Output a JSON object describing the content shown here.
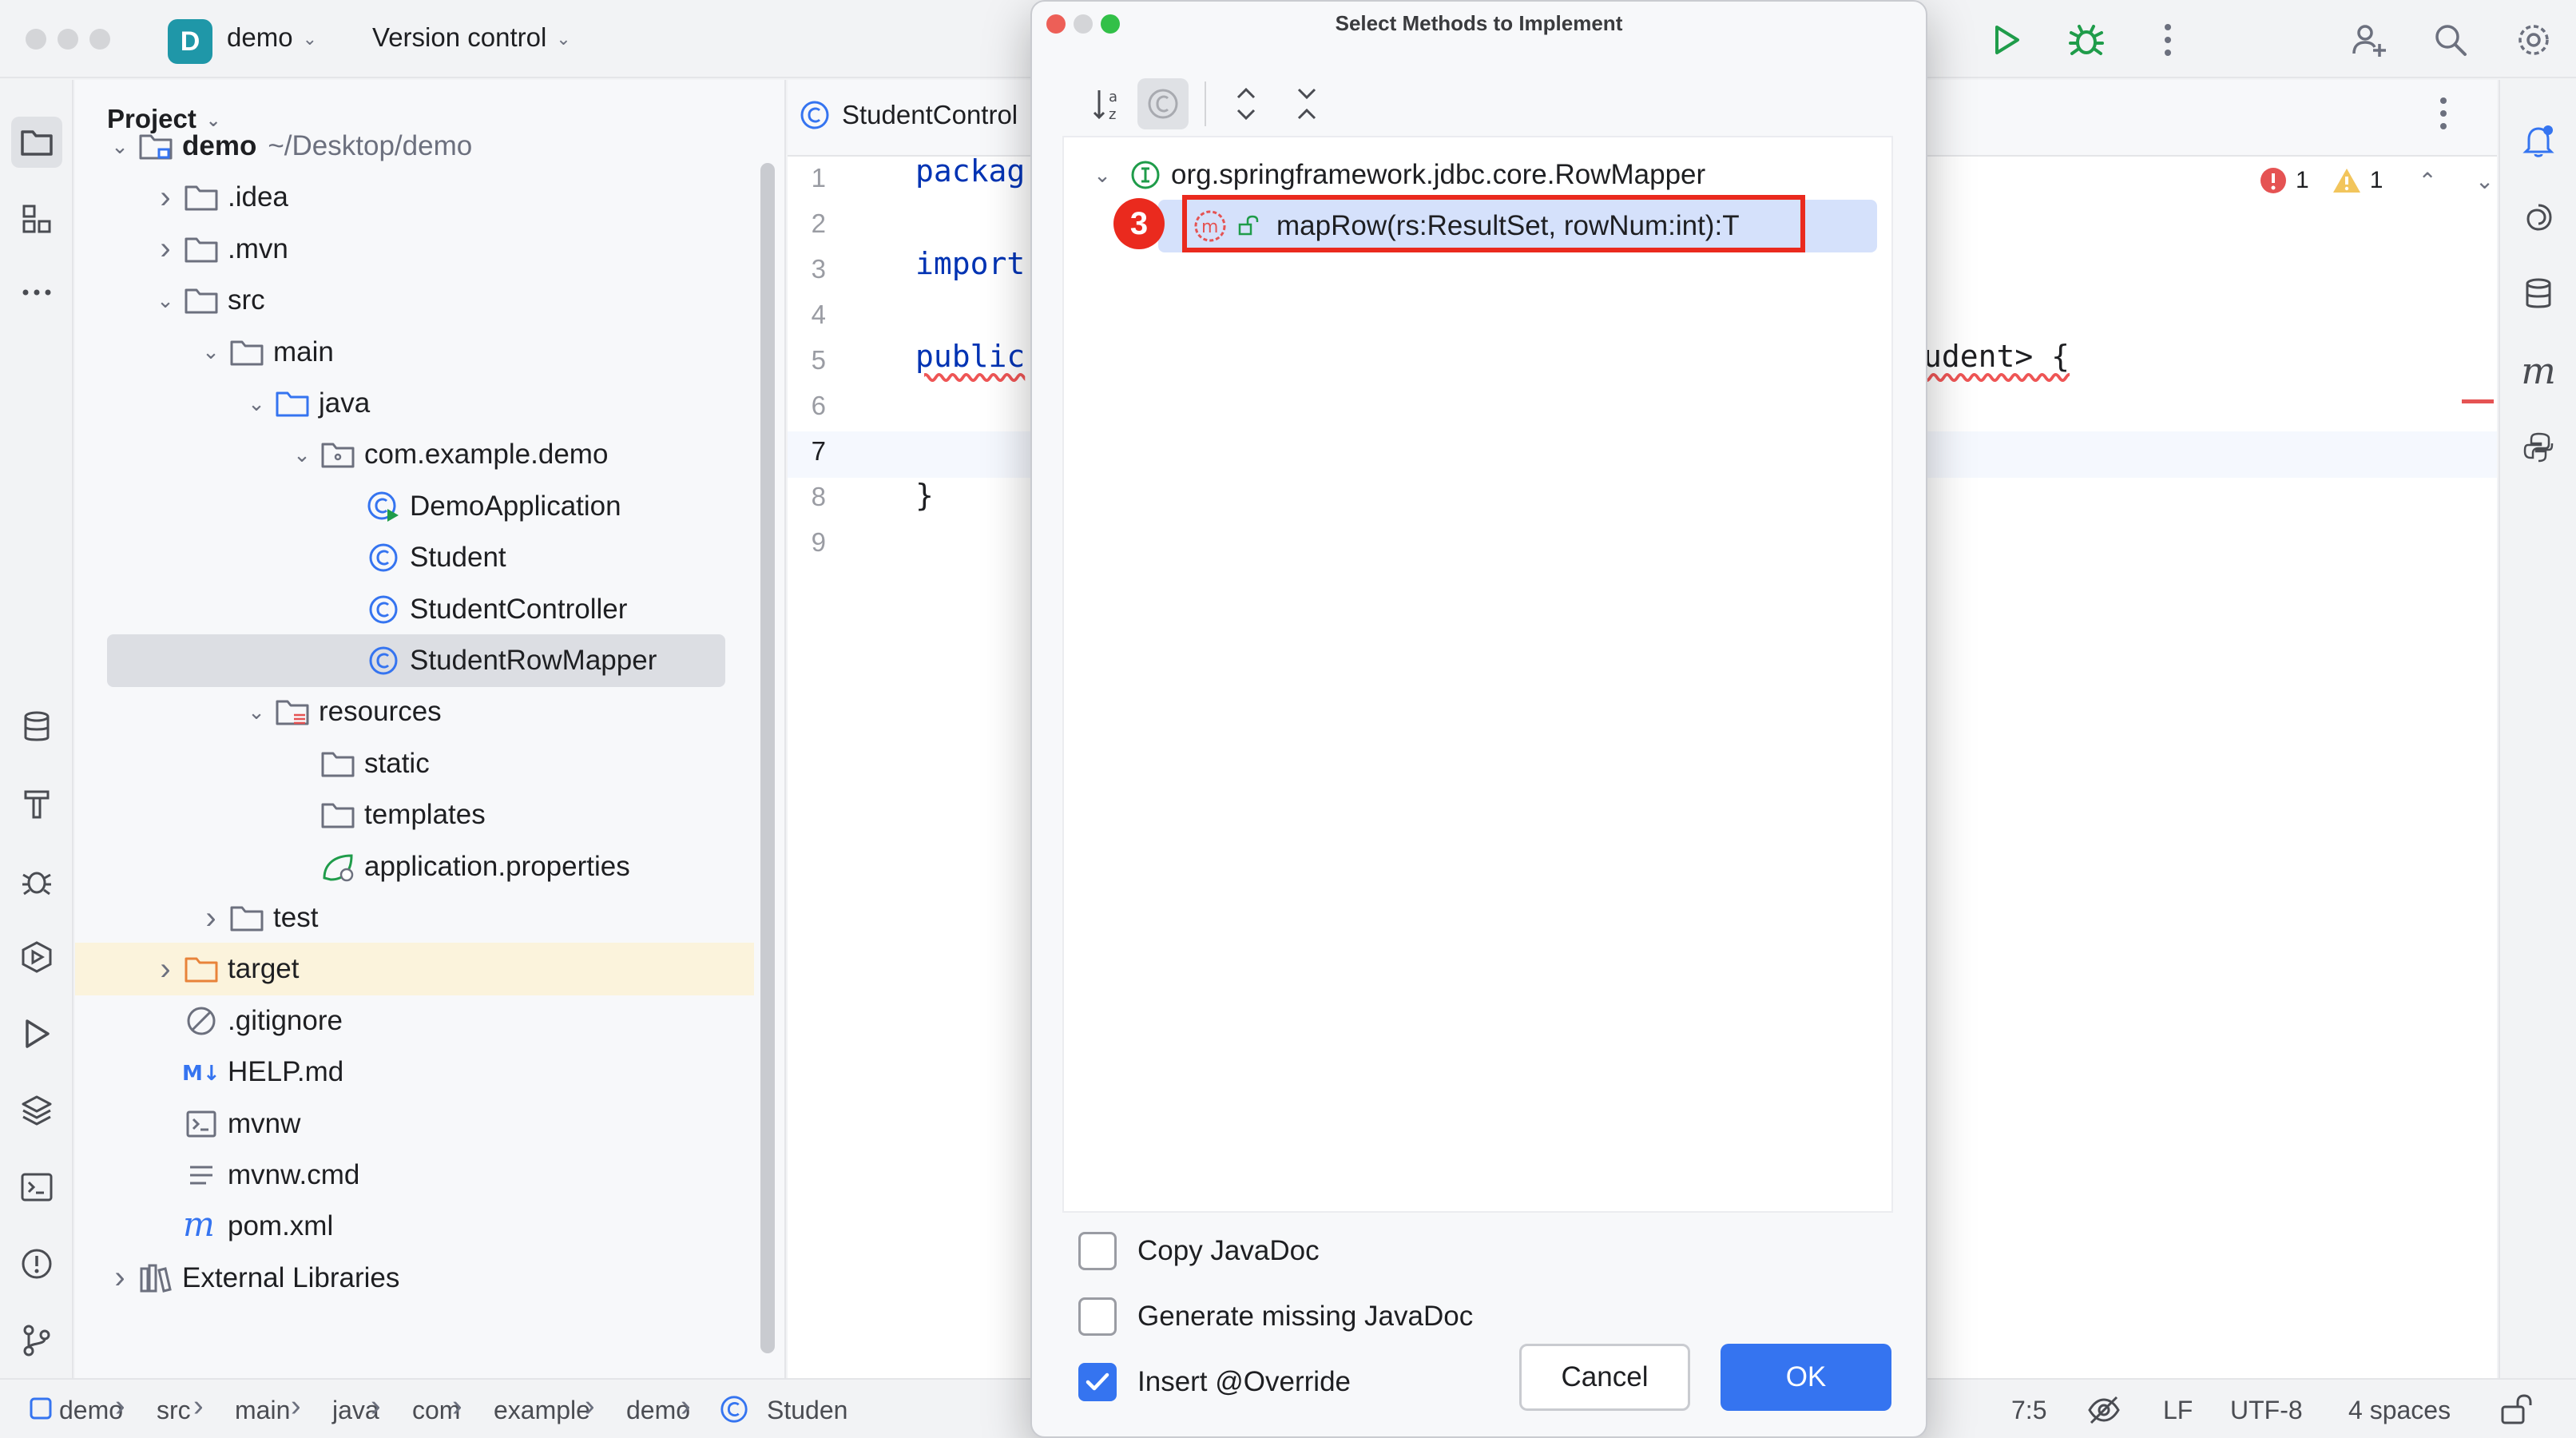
{
  "titlebar": {
    "project_badge": "D",
    "project_name": "demo",
    "vcs_label": "Version control"
  },
  "project_panel": {
    "title": "Project",
    "tree": [
      {
        "label": "demo",
        "sub": "~/Desktop/demo",
        "icon": "module-folder-icon",
        "indent": 0,
        "arrow": "down",
        "bold": true
      },
      {
        "label": ".idea",
        "icon": "folder-icon",
        "indent": 1,
        "arrow": "right"
      },
      {
        "label": ".mvn",
        "icon": "folder-icon",
        "indent": 1,
        "arrow": "right"
      },
      {
        "label": "src",
        "icon": "folder-icon",
        "indent": 1,
        "arrow": "down"
      },
      {
        "label": "main",
        "icon": "folder-icon",
        "indent": 2,
        "arrow": "down"
      },
      {
        "label": "java",
        "icon": "source-folder-icon",
        "indent": 3,
        "arrow": "down"
      },
      {
        "label": "com.example.demo",
        "icon": "package-icon",
        "indent": 4,
        "arrow": "down"
      },
      {
        "label": "DemoApplication",
        "icon": "spring-class-icon",
        "indent": 5,
        "arrow": ""
      },
      {
        "label": "Student",
        "icon": "class-icon",
        "indent": 5,
        "arrow": ""
      },
      {
        "label": "StudentController",
        "icon": "class-icon",
        "indent": 5,
        "arrow": ""
      },
      {
        "label": "StudentRowMapper",
        "icon": "class-icon",
        "indent": 5,
        "arrow": "",
        "selected": true
      },
      {
        "label": "resources",
        "icon": "resources-folder-icon",
        "indent": 3,
        "arrow": "down"
      },
      {
        "label": "static",
        "icon": "folder-icon",
        "indent": 4,
        "arrow": ""
      },
      {
        "label": "templates",
        "icon": "folder-icon",
        "indent": 4,
        "arrow": ""
      },
      {
        "label": "application.properties",
        "icon": "spring-properties-icon",
        "indent": 4,
        "arrow": ""
      },
      {
        "label": "test",
        "icon": "folder-icon",
        "indent": 2,
        "arrow": "right"
      },
      {
        "label": "target",
        "icon": "excluded-folder-icon",
        "indent": 1,
        "arrow": "right",
        "highlight": true
      },
      {
        "label": ".gitignore",
        "icon": "ignore-file-icon",
        "indent": 1,
        "arrow": ""
      },
      {
        "label": "HELP.md",
        "icon": "markdown-icon",
        "indent": 1,
        "arrow": ""
      },
      {
        "label": "mvnw",
        "icon": "shell-script-icon",
        "indent": 1,
        "arrow": ""
      },
      {
        "label": "mvnw.cmd",
        "icon": "text-file-icon",
        "indent": 1,
        "arrow": ""
      },
      {
        "label": "pom.xml",
        "icon": "maven-icon",
        "indent": 1,
        "arrow": ""
      },
      {
        "label": "External Libraries",
        "icon": "libraries-icon",
        "indent": 0,
        "arrow": "right"
      }
    ]
  },
  "editor": {
    "tab_label": "StudentControl",
    "line_numbers": [
      "1",
      "2",
      "3",
      "4",
      "5",
      "6",
      "7",
      "8",
      "9"
    ],
    "code": {
      "line1": "packag",
      "line3": "import",
      "line5_kw": "public",
      "line5_tail": "udent> {",
      "line8": "}"
    },
    "inspections": {
      "errors": "1",
      "warnings": "1"
    }
  },
  "dialog": {
    "title": "Select Methods to Implement",
    "interface_name": "org.springframework.jdbc.core.RowMapper",
    "method": "mapRow(rs:ResultSet, rowNum:int):T",
    "step_badge": "3",
    "options": [
      {
        "label": "Copy JavaDoc",
        "checked": false
      },
      {
        "label": "Generate missing JavaDoc",
        "checked": false
      },
      {
        "label": "Insert @Override",
        "checked": true
      }
    ],
    "cancel_label": "Cancel",
    "ok_label": "OK"
  },
  "statusbar": {
    "breadcrumbs": [
      "demo",
      "src",
      "main",
      "java",
      "com",
      "example",
      "demo",
      "Studen"
    ],
    "position": "7:5",
    "line_sep": "LF",
    "encoding": "UTF-8",
    "indent": "4 spaces"
  },
  "colors": {
    "accent": "#3574f0",
    "annotation_red": "#ea2a1e",
    "selection": "#d5e1fb",
    "keyword": "#0033b3"
  }
}
